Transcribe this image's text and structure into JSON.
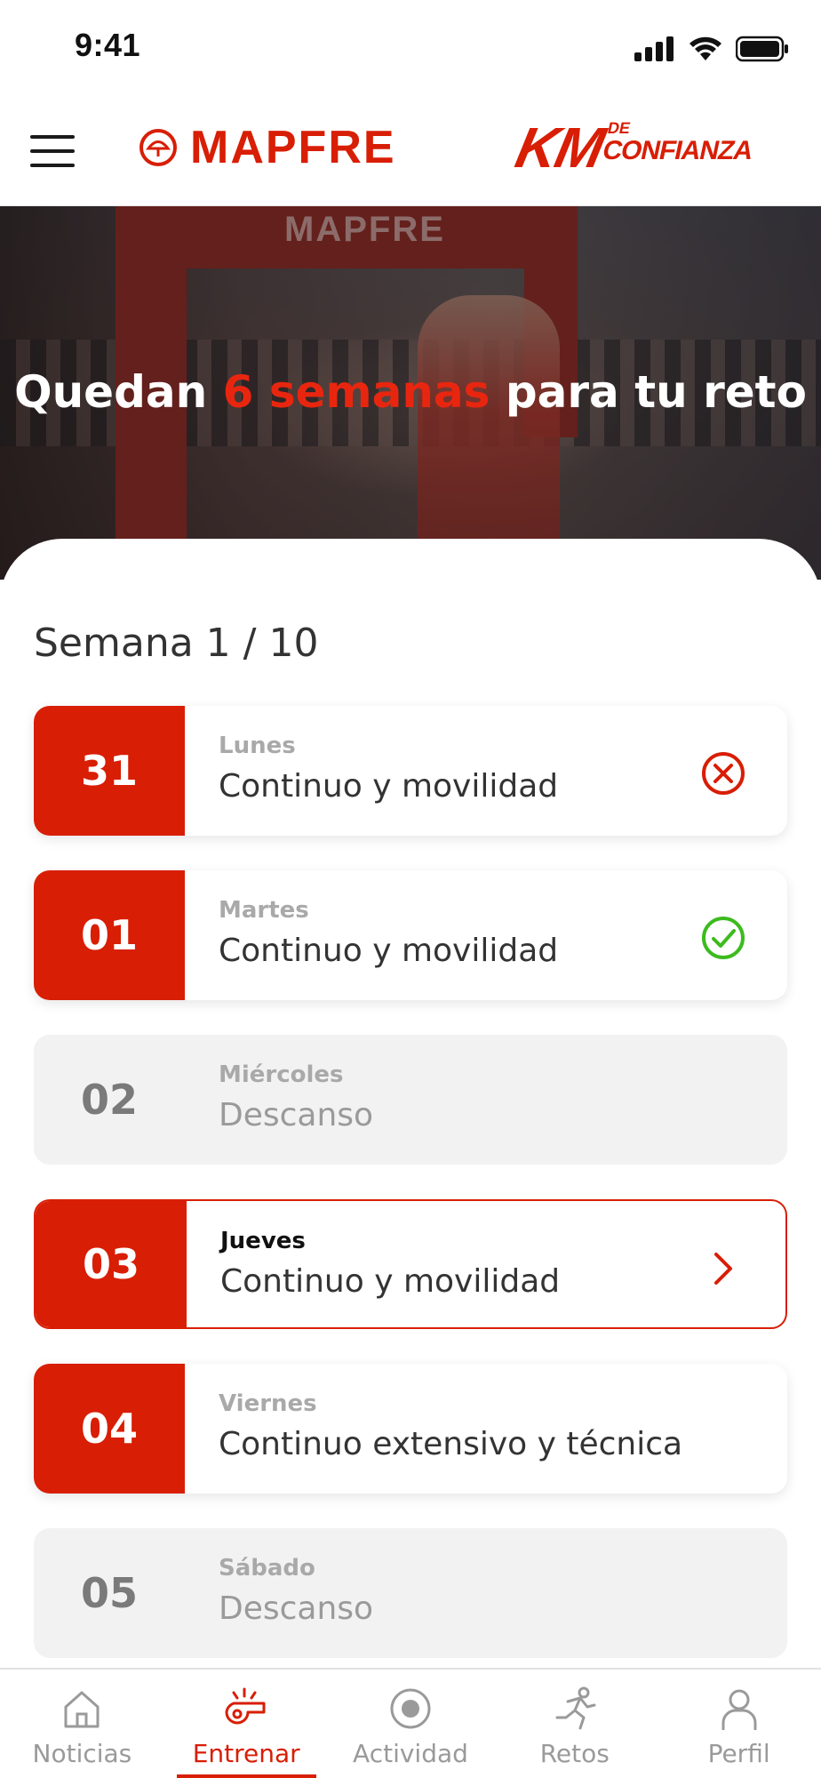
{
  "status_bar": {
    "time": "9:41"
  },
  "header": {
    "brand": "MAPFRE",
    "campaign_main": "KM",
    "campaign_de": "DE",
    "campaign_sub": "CONFIANZA"
  },
  "hero": {
    "prefix": "Quedan",
    "highlight": "6 semanas",
    "suffix": "para tu reto",
    "background_brand": "MAPFRE"
  },
  "week": {
    "title": "Semana 1 / 10"
  },
  "days": [
    {
      "number": "31",
      "name": "Lunes",
      "activity": "Continuo y movilidad",
      "status": "missed"
    },
    {
      "number": "01",
      "name": "Martes",
      "activity": "Continuo y movilidad",
      "status": "done"
    },
    {
      "number": "02",
      "name": "Miércoles",
      "activity": "Descanso",
      "status": "rest"
    },
    {
      "number": "03",
      "name": "Jueves",
      "activity": "Continuo y movilidad",
      "status": "current"
    },
    {
      "number": "04",
      "name": "Viernes",
      "activity": "Continuo extensivo y técnica",
      "status": "pending"
    },
    {
      "number": "05",
      "name": "Sábado",
      "activity": "Descanso",
      "status": "rest"
    }
  ],
  "tabs": [
    {
      "label": "Noticias",
      "icon": "home-icon",
      "active": false
    },
    {
      "label": "Entrenar",
      "icon": "whistle-icon",
      "active": true
    },
    {
      "label": "Actividad",
      "icon": "record-icon",
      "active": false
    },
    {
      "label": "Retos",
      "icon": "runner-icon",
      "active": false
    },
    {
      "label": "Perfil",
      "icon": "user-icon",
      "active": false
    }
  ],
  "colors": {
    "brand_red": "#d81e05",
    "success_green": "#3dbb1e",
    "rest_gray": "#f2f2f2",
    "muted_text": "#9a9a9a"
  }
}
